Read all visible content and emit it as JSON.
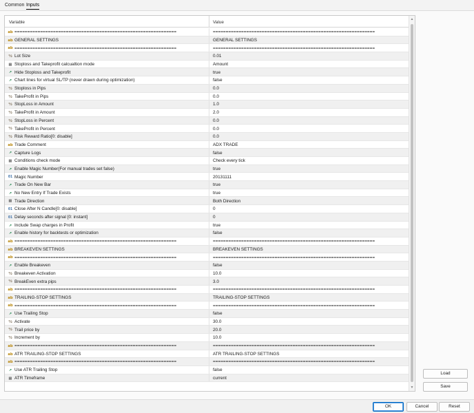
{
  "tabs": {
    "common": "Common",
    "inputs": "Inputs",
    "active": "Inputs"
  },
  "grid": {
    "header": {
      "variable": "Variable",
      "value": "Value"
    },
    "rows": [
      {
        "icon": "ab",
        "name": "===============================================================",
        "value": "==============================================================="
      },
      {
        "icon": "ab",
        "name": "GENERAL SETTINGS",
        "value": "GENERAL SETTINGS"
      },
      {
        "icon": "ab",
        "name": "===============================================================",
        "value": "==============================================================="
      },
      {
        "icon": "num",
        "name": "Lot Size",
        "value": "0.01"
      },
      {
        "icon": "enum",
        "name": "Stoploss and Takeprofit calcualtion mode",
        "value": "Amount"
      },
      {
        "icon": "bool",
        "name": "Hide Stoploss and Takeprofit",
        "value": "true"
      },
      {
        "icon": "bool",
        "name": "Chart lines for virtual SL/TP (never drawn during optimization)",
        "value": "false"
      },
      {
        "icon": "num",
        "name": "Stoploss in Pips",
        "value": "0.0"
      },
      {
        "icon": "num",
        "name": "TakeProfit in Pips",
        "value": "0.0"
      },
      {
        "icon": "num",
        "name": "StopLoss in Amount",
        "value": "1.0"
      },
      {
        "icon": "num",
        "name": "TakeProfit in Amount",
        "value": "2.0"
      },
      {
        "icon": "num",
        "name": "StopLoss in Percent",
        "value": "0.0"
      },
      {
        "icon": "num",
        "name": "TakeProfit in Percent",
        "value": "0.0"
      },
      {
        "icon": "num",
        "name": "Risk Reward Ratio[0: disable]",
        "value": "0.0"
      },
      {
        "icon": "ab",
        "name": "Trade Comment",
        "value": "ADX TRADE"
      },
      {
        "icon": "bool",
        "name": "Capture Logs",
        "value": "false"
      },
      {
        "icon": "enum",
        "name": "Conditions check mode",
        "value": "Check every tick"
      },
      {
        "icon": "bool",
        "name": "Enable Magic Number(For manual trades set false)",
        "value": "true"
      },
      {
        "icon": "int",
        "name": "Magic Number",
        "value": "20131111"
      },
      {
        "icon": "bool",
        "name": "Trade On New Bar",
        "value": "true"
      },
      {
        "icon": "bool",
        "name": "No New Entry If Trade Exists",
        "value": "true"
      },
      {
        "icon": "enum",
        "name": "Trade Direction",
        "value": "Both Direction"
      },
      {
        "icon": "int",
        "name": "Close After N Candle[0: disable]",
        "value": "0"
      },
      {
        "icon": "int",
        "name": "Delay seconds after signal [0: instant]",
        "value": "0"
      },
      {
        "icon": "bool",
        "name": "Include Swap charges in Profit",
        "value": "true"
      },
      {
        "icon": "bool",
        "name": "Enable history for backtests or optimization",
        "value": "false"
      },
      {
        "icon": "ab",
        "name": "===============================================================",
        "value": "==============================================================="
      },
      {
        "icon": "ab",
        "name": "BREAKEVEN SETTINGS",
        "value": "BREAKEVEN SETTINGS"
      },
      {
        "icon": "ab",
        "name": "===============================================================",
        "value": "==============================================================="
      },
      {
        "icon": "bool",
        "name": "Enable Breakeven",
        "value": "false"
      },
      {
        "icon": "num",
        "name": "Breakeven Activation",
        "value": "10.0"
      },
      {
        "icon": "num",
        "name": "BreakEven extra pips",
        "value": "3.0"
      },
      {
        "icon": "ab",
        "name": "===============================================================",
        "value": "==============================================================="
      },
      {
        "icon": "ab",
        "name": "TRAILING-STOP SETTINGS",
        "value": "TRAILING-STOP SETTINGS"
      },
      {
        "icon": "ab",
        "name": "===============================================================",
        "value": "==============================================================="
      },
      {
        "icon": "bool",
        "name": "Use Trailing Stop",
        "value": "false"
      },
      {
        "icon": "num",
        "name": "Activate",
        "value": "30.0"
      },
      {
        "icon": "num",
        "name": "Trail price by",
        "value": "20.0"
      },
      {
        "icon": "num",
        "name": "Increment by",
        "value": "10.0"
      },
      {
        "icon": "ab",
        "name": "===============================================================",
        "value": "==============================================================="
      },
      {
        "icon": "ab",
        "name": "ATR TRAILING-STOP SETTINGS",
        "value": "ATR TRAILING-STOP SETTINGS"
      },
      {
        "icon": "ab",
        "name": "===============================================================",
        "value": "==============================================================="
      },
      {
        "icon": "bool",
        "name": "Use ATR Trailing Stop",
        "value": "false"
      },
      {
        "icon": "enum",
        "name": "ATR Timeframe",
        "value": "current"
      }
    ]
  },
  "icons": {
    "ab": {
      "glyph": "ab",
      "name": "string-type-icon"
    },
    "bool": {
      "glyph": "↗",
      "name": "bool-type-icon"
    },
    "num": {
      "glyph": "½",
      "name": "double-type-icon"
    },
    "int": {
      "glyph": "01",
      "name": "int-type-icon"
    },
    "enum": {
      "glyph": "▤",
      "name": "enum-type-icon"
    }
  },
  "side_buttons": {
    "load": "Load",
    "save": "Save"
  },
  "footer": {
    "ok": "OK",
    "cancel": "Cancel",
    "reset": "Reset"
  },
  "colors": {
    "accent": "#0067c0",
    "row_alt": "#f0f0f0",
    "string_icon": "#b8860b",
    "bool_icon": "#2e8b57"
  }
}
